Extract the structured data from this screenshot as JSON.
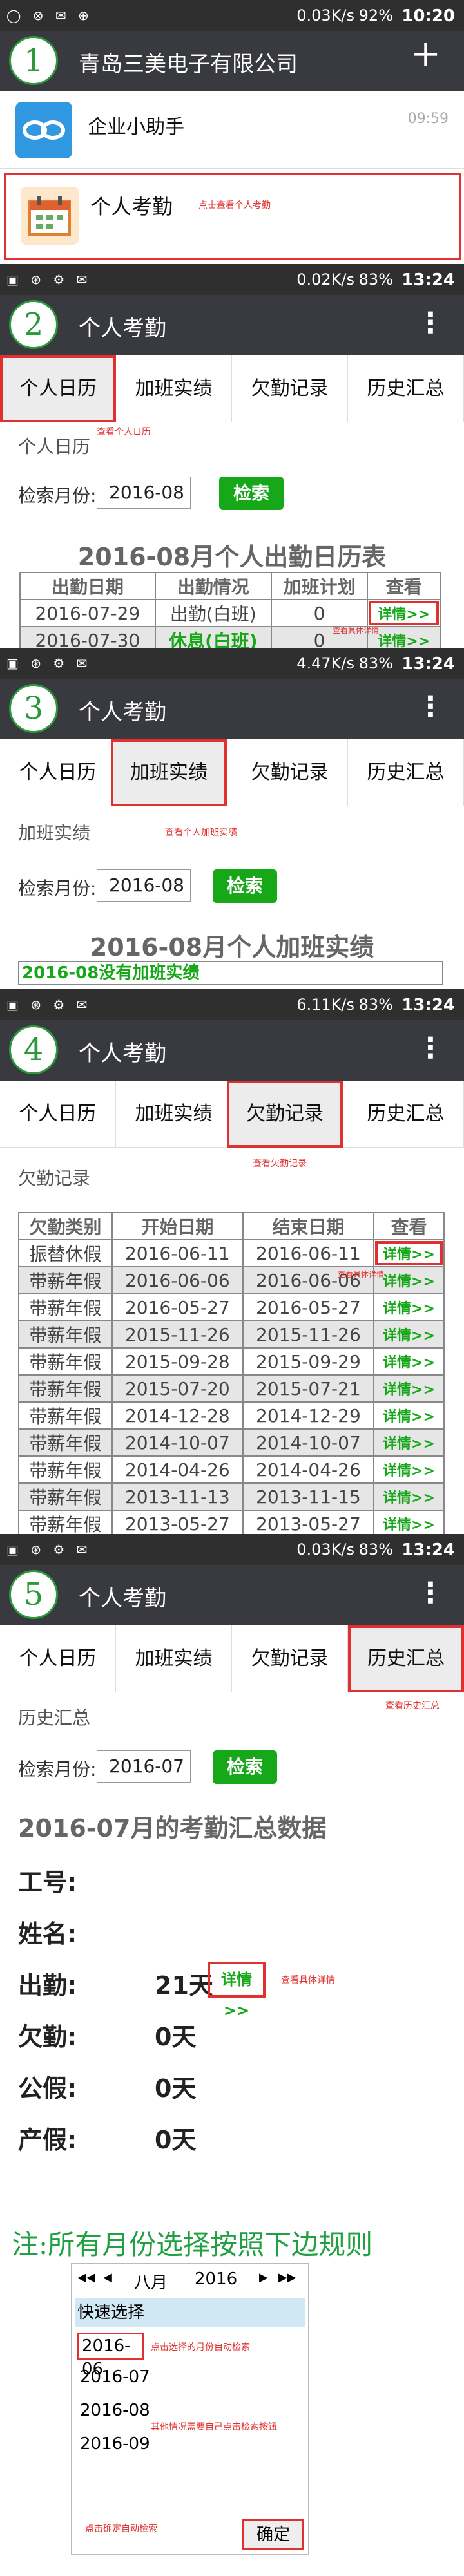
{
  "s1": {
    "status_left": "◯ ⊗ ✉ ⊕",
    "status_net": "0.03K/s",
    "status_batt": "92%",
    "status_time": "10:20",
    "num": "1",
    "title": "青岛三美电子有限公司",
    "plus": "+",
    "chat1_name": "企业小助手",
    "chat1_time": "09:59",
    "chat2_name": "个人考勤",
    "chat2_hint": "点击查看个人考勤"
  },
  "s2": {
    "status_net": "0.02K/s",
    "status_batt": "83%",
    "status_time": "13:24",
    "num": "2",
    "title": "个人考勤",
    "tabs": [
      "个人日历",
      "加班实绩",
      "欠勤记录",
      "历史汇总"
    ],
    "tab_hint": "查看个人日历",
    "section": "个人日历",
    "search_label": "检索月份:",
    "month": "2016-08",
    "search_btn": "检索",
    "heading": "2016-08月个人出勤日历表",
    "headers": [
      "出勤日期",
      "出勤情况",
      "加班计划",
      "查看"
    ],
    "rows": [
      [
        "2016-07-29",
        "出勤(白班)",
        "0",
        "详情>>"
      ],
      [
        "2016-07-30",
        "休息(白班)",
        "0",
        "详情>>"
      ]
    ],
    "detail_hint": "查看具体详情"
  },
  "s3": {
    "status_net": "4.47K/s",
    "status_batt": "83%",
    "status_time": "13:24",
    "num": "3",
    "title": "个人考勤",
    "tab_hint": "查看个人加班实绩",
    "section": "加班实绩",
    "search_label": "检索月份:",
    "month": "2016-08",
    "search_btn": "检索",
    "heading": "2016-08月个人加班实绩",
    "empty": "2016-08没有加班实绩"
  },
  "s4": {
    "status_net": "6.11K/s",
    "status_batt": "83%",
    "status_time": "13:24",
    "num": "4",
    "title": "个人考勤",
    "tab_hint": "查看欠勤记录",
    "section": "欠勤记录",
    "headers": [
      "欠勤类别",
      "开始日期",
      "结束日期",
      "查看"
    ],
    "rows": [
      [
        "振替休假",
        "2016-06-11",
        "2016-06-11",
        "详情>>"
      ],
      [
        "带薪年假",
        "2016-06-06",
        "2016-06-06",
        "详情>>"
      ],
      [
        "带薪年假",
        "2016-05-27",
        "2016-05-27",
        "详情>>"
      ],
      [
        "带薪年假",
        "2015-11-26",
        "2015-11-26",
        "详情>>"
      ],
      [
        "带薪年假",
        "2015-09-28",
        "2015-09-29",
        "详情>>"
      ],
      [
        "带薪年假",
        "2015-07-20",
        "2015-07-21",
        "详情>>"
      ],
      [
        "带薪年假",
        "2014-12-28",
        "2014-12-29",
        "详情>>"
      ],
      [
        "带薪年假",
        "2014-10-07",
        "2014-10-07",
        "详情>>"
      ],
      [
        "带薪年假",
        "2014-04-26",
        "2014-04-26",
        "详情>>"
      ],
      [
        "带薪年假",
        "2013-11-13",
        "2013-11-15",
        "详情>>"
      ],
      [
        "带薪年假",
        "2013-05-27",
        "2013-05-27",
        "详情>>"
      ]
    ],
    "detail_hint": "查看具体详情"
  },
  "s5": {
    "status_net": "0.03K/s",
    "status_batt": "83%",
    "status_time": "13:24",
    "num": "5",
    "title": "个人考勤",
    "tab_hint": "查看历史汇总",
    "section": "历史汇总",
    "search_label": "检索月份:",
    "month": "2016-07",
    "search_btn": "检索",
    "heading": "2016-07月的考勤汇总数据",
    "items": [
      {
        "label": "工号:",
        "value": ""
      },
      {
        "label": "姓名:",
        "value": ""
      },
      {
        "label": "出勤:",
        "value": "21天"
      },
      {
        "label": "欠勤:",
        "value": "0天"
      },
      {
        "label": "公假:",
        "value": "0天"
      },
      {
        "label": "产假:",
        "value": "0天"
      }
    ],
    "detail_btn": "详情 >>",
    "detail_hint": "查看具体详情"
  },
  "note": {
    "text": "注:所有月份选择按照下边规则",
    "nav_prev2": "◀◀",
    "nav_prev": "◀",
    "month_label": "八月",
    "year_label": "2016",
    "nav_next": "▶",
    "nav_next2": "▶▶",
    "quick": "快速选择",
    "options": [
      "2016-06",
      "2016-07",
      "2016-08",
      "2016-09"
    ],
    "hint_select": "点击选择的月份自动检索",
    "hint_other": "其他情况需要自己点击检索按钮",
    "hint_confirm": "点击确定自动检索",
    "confirm": "确定"
  },
  "colors": {
    "accent": "#17a81a",
    "highlight": "#e03030",
    "titlebar": "#393a3f"
  }
}
